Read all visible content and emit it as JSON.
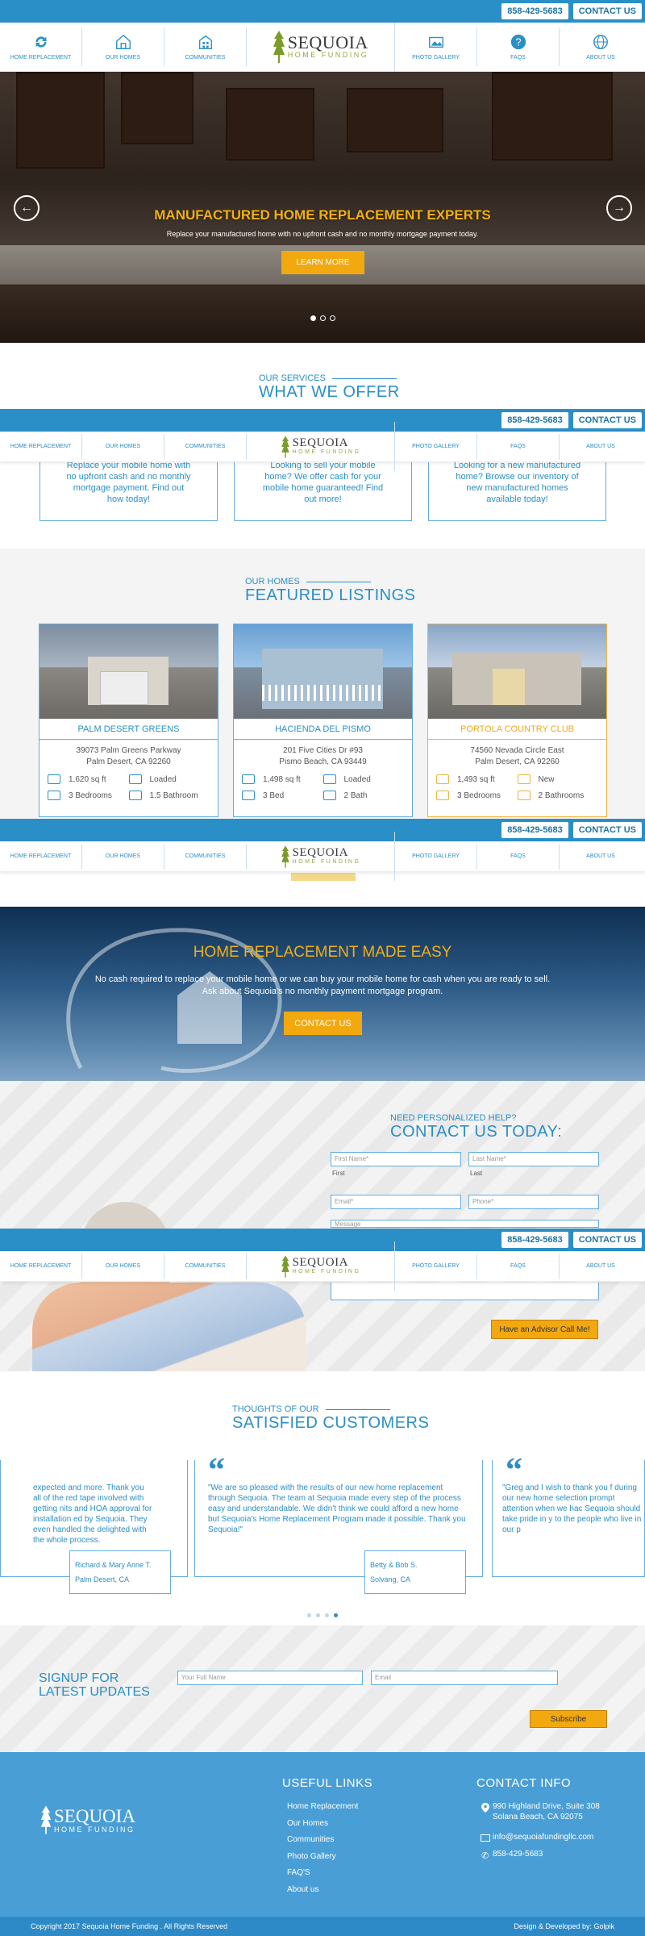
{
  "header": {
    "phone": "858-429-5683",
    "contact_btn": "CONTACT US",
    "nav": [
      "HOME REPLACEMENT",
      "OUR HOMES",
      "COMMUNITIES",
      "PHOTO GALLERY",
      "FAQS",
      "ABOUT US"
    ],
    "logo_name": "SEQUOIA",
    "logo_sub": "HOME FUNDING"
  },
  "hero": {
    "title": "MANUFACTURED HOME REPLACEMENT EXPERTS",
    "subtitle": "Replace your manufactured home with no upfront cash and no monthly mortgage payment today.",
    "button": "LEARN MORE",
    "prev_arrow": "←",
    "next_arrow": "→"
  },
  "services": {
    "small": "OUR SERVICES",
    "big": "WHAT WE OFFER",
    "items": [
      "Replace your mobile home with no upfront cash and no monthly mortgage payment. Find out how today!",
      "Looking to sell your mobile home? We offer cash for your mobile home guaranteed! Find out more!",
      "Looking for a new manufactured home? Browse our inventory of new manufactured homes available today!"
    ]
  },
  "listings": {
    "small": "OUR HOMES",
    "big": "FEATURED LISTINGS",
    "cards": [
      {
        "name": "PALM DESERT GREENS",
        "addr1": "39073 Palm Greens Parkway",
        "addr2": "Palm Desert, CA 92260",
        "sqft": "1,620 sq ft",
        "status": "Loaded",
        "beds": "3 Bedrooms",
        "baths": "1.5 Bathroom"
      },
      {
        "name": "HACIENDA DEL PISMO",
        "addr1": "201 Five Cities Dr #93",
        "addr2": "Pismo Beach, CA 93449",
        "sqft": "1,498 sq ft",
        "status": "Loaded",
        "beds": "3 Bed",
        "baths": "2 Bath"
      },
      {
        "name": "PORTOLA COUNTRY CLUB",
        "addr1": "74560 Nevada Circle East",
        "addr2": "Palm Desert, CA 92260",
        "sqft": "1,493 sq ft",
        "status": "New",
        "beds": "3 Bedrooms",
        "baths": "2 Bathrooms"
      }
    ]
  },
  "made_easy": {
    "title": "HOME REPLACEMENT MADE EASY",
    "text": "No cash required to replace your mobile home or we can buy your mobile home for cash when you are ready to sell. Ask about Sequoia's no monthly payment mortgage program.",
    "button": "CONTACT US"
  },
  "contact": {
    "small": "NEED PERSONALIZED HELP?",
    "big": "CONTACT US TODAY:",
    "first_placeholder": "First Name*",
    "last_placeholder": "Last Name*",
    "first_label": "First",
    "last_label": "Last",
    "email_placeholder": "Email*",
    "phone_placeholder": "Phone*",
    "message_placeholder": "Message",
    "button": "Have an Advisor Call Me!"
  },
  "testimonials": {
    "small": "THOUGHTS OF OUR",
    "big": "SATISFIED CUSTOMERS",
    "items": [
      {
        "text": "expected and more. Thank you all of the red tape involved with getting nits and HOA approval for installation ed by Sequoia. They even handled the delighted with the whole process.",
        "name": "Richard & Mary Anne T.",
        "place": "Palm Desert, CA"
      },
      {
        "text": "\"We are so pleased with the results of our new home replacement through Sequoia. The team at Sequoia made every step of the process easy and understandable. We didn't think we could afford a new home but Sequoia's Home Replacement Program made it possible. Thank you Sequoia!\"",
        "name": "Betty & Bob S.",
        "place": "Solvang, CA"
      },
      {
        "text": "\"Greg and I wish to thank you f during our new home selection prompt attention when we hac Sequoia should take pride in y to the people who live in our p",
        "name": "",
        "place": ""
      }
    ]
  },
  "signup": {
    "title_line1": "SIGNUP FOR",
    "title_line2": "LATEST UPDATES",
    "name_placeholder": "Your Full Name",
    "email_placeholder": "Email",
    "button": "Subscribe"
  },
  "footer": {
    "logo_name": "SEQUOIA",
    "logo_sub": "HOME FUNDING",
    "links_head": "USEFUL LINKS",
    "links": [
      "Home Replacement",
      "Our Homes",
      "Communities",
      "Photo Gallery",
      "FAQ'S",
      "About us"
    ],
    "contact_head": "CONTACT INFO",
    "address1": "990 Highland Drive, Suite 308",
    "address2": "Solana Beach, CA 92075",
    "email": "info@sequoiafundingllc.com",
    "phone": "858-429-5683",
    "copyright": "Copyright 2017 Sequoia Home Funding . All Rights Reserved",
    "credit": "Design & Developed by: Golpik"
  }
}
